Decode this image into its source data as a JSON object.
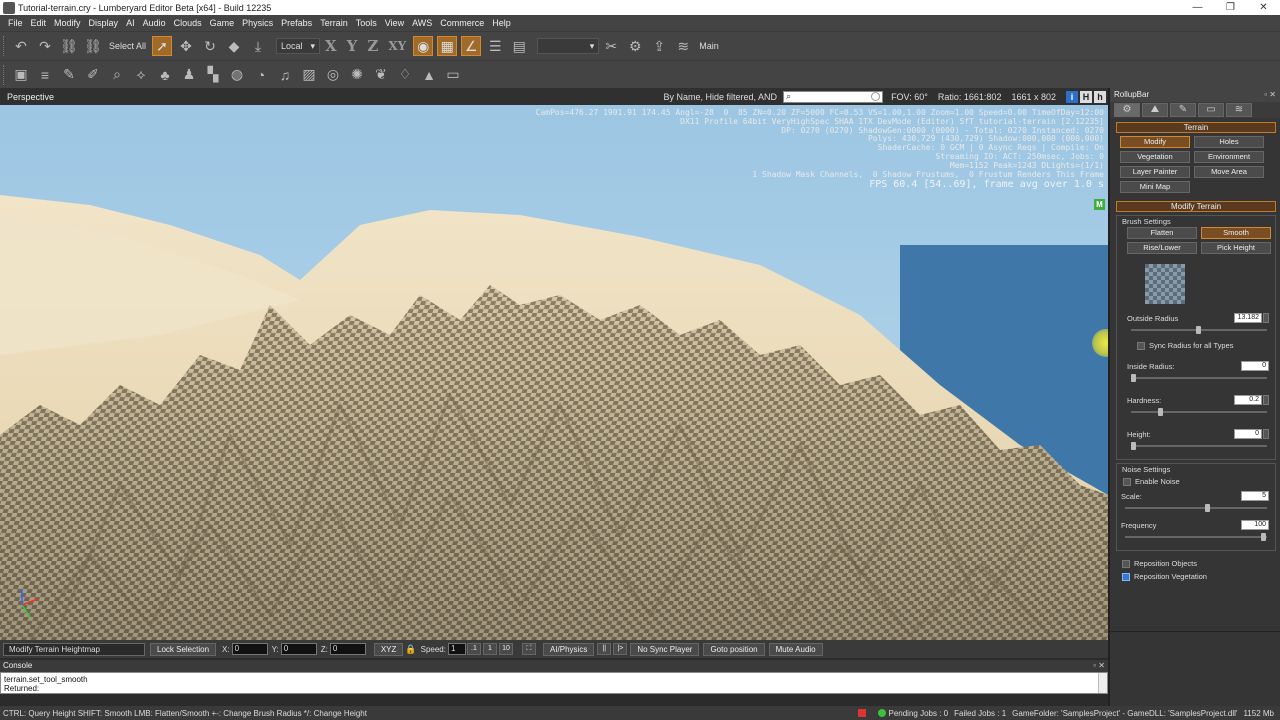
{
  "window": {
    "title": "Tutorial-terrain.cry - Lumberyard Editor Beta [x64] - Build 12235",
    "controls": [
      "—",
      "❐",
      "✕"
    ]
  },
  "menu": [
    "File",
    "Edit",
    "Modify",
    "Display",
    "AI",
    "Audio",
    "Clouds",
    "Game",
    "Physics",
    "Prefabs",
    "Terrain",
    "Tools",
    "View",
    "AWS",
    "Commerce",
    "Help"
  ],
  "toolbar": {
    "select_all": "Select All",
    "coord_space": "Local",
    "axis_letters": [
      "X",
      "Y",
      "Z",
      "XY"
    ],
    "main_label": "Main"
  },
  "viewport": {
    "title": "Perspective",
    "filter": "By Name, Hide filtered, AND",
    "fov_label": "FOV:",
    "fov_value": "60°",
    "ratio_label": "Ratio:",
    "ratio_value": "1661:802",
    "resolution": "1661 x 802",
    "buttons": [
      "i",
      "H",
      "h"
    ],
    "debug_lines": [
      "CamPos=476.27 1901.91 174.45 Angl=-28  0  85 ZN=0.20 ZF=5000 FC=0.53 VS=1.00,1.00 Zoom=1.00 Speed=0.00 TimeOfDay=12:00",
      "DX11 Profile 64bit VeryHighSpec SHAA 1TX DevMode (Editor) SfT tutorial-terrain [2.12235]",
      "DP: 0270 (0270) ShadowGen:0000 (0000) - Total: 0270 Instanced: 0270",
      "Polys: 430,729 (430,729) Shadow:000,000 (000,000)",
      "ShaderCache: 0 GCM | 0 Async Reqs | Compile: On",
      "Streaming IO: ACT: 250msec, Jobs: 0",
      "Mem=1152 Peak=1243 DLights=(1/1)",
      "1 Shadow Mask Channels,  0 Shadow Frustums,  0 Frustum Renders This Frame"
    ],
    "fps_line": "FPS 60.4 [54..69], frame avg over 1.0 s",
    "marker": "M"
  },
  "statusstrip": {
    "mode": "Modify Terrain Heightmap",
    "lock": "Lock Selection",
    "x_label": "X:",
    "y_label": "Y:",
    "z_label": "Z:",
    "x_value": "0",
    "y_value": "0",
    "z_value": "0",
    "xyz": "XYZ",
    "speed_label": "Speed:",
    "speed_value": "1",
    "speed_steps": [
      ".1",
      "1",
      "10"
    ],
    "ai_physics": "AI/Physics",
    "sync_player": "No Sync Player",
    "goto": "Goto position",
    "mute": "Mute Audio"
  },
  "console": {
    "title": "Console",
    "lines": [
      "terrain.set_tool_smooth",
      "Returned:"
    ]
  },
  "statusbar": {
    "hint": "CTRL: Query Height  SHIFT: Smooth  LMB: Flatten/Smooth  +-: Change Brush Radius  */: Change Height",
    "pending": "Pending Jobs : 0",
    "failed": "Failed Jobs : 1",
    "gamefolder": "GameFolder: 'SamplesProject' - GameDLL: 'SamplesProject.dll'",
    "mem": "1152 Mb"
  },
  "rollup": {
    "title": "RollupBar",
    "terrain_header": "Terrain",
    "terrain_buttons": [
      "Modify",
      "Holes",
      "Vegetation",
      "Environment",
      "Layer Painter",
      "Move Area",
      "Mini Map"
    ],
    "modify_header": "Modify Terrain",
    "brush_settings": "Brush Settings",
    "brush_buttons": [
      "Flatten",
      "Smooth",
      "Rise/Lower",
      "Pick Height"
    ],
    "outside_radius_label": "Outside Radius",
    "outside_radius_value": "13.182",
    "sync_radius_label": "Sync Radius for all Types",
    "inside_radius_label": "Inside Radius:",
    "inside_radius_value": "0",
    "hardness_label": "Hardness:",
    "hardness_value": "0.2",
    "height_label": "Height:",
    "height_value": "0",
    "noise_settings": "Noise Settings",
    "enable_noise_label": "Enable Noise",
    "scale_label": "Scale:",
    "scale_value": "5",
    "frequency_label": "Frequency",
    "frequency_value": "100",
    "reposition_objects": "Reposition Objects",
    "reposition_vegetation": "Reposition Vegetation"
  },
  "colors": {
    "accent": "#d38a2e",
    "selected_button": "#7a4d22",
    "sky": "#a8cde6",
    "sand": "#e9d9b8"
  }
}
